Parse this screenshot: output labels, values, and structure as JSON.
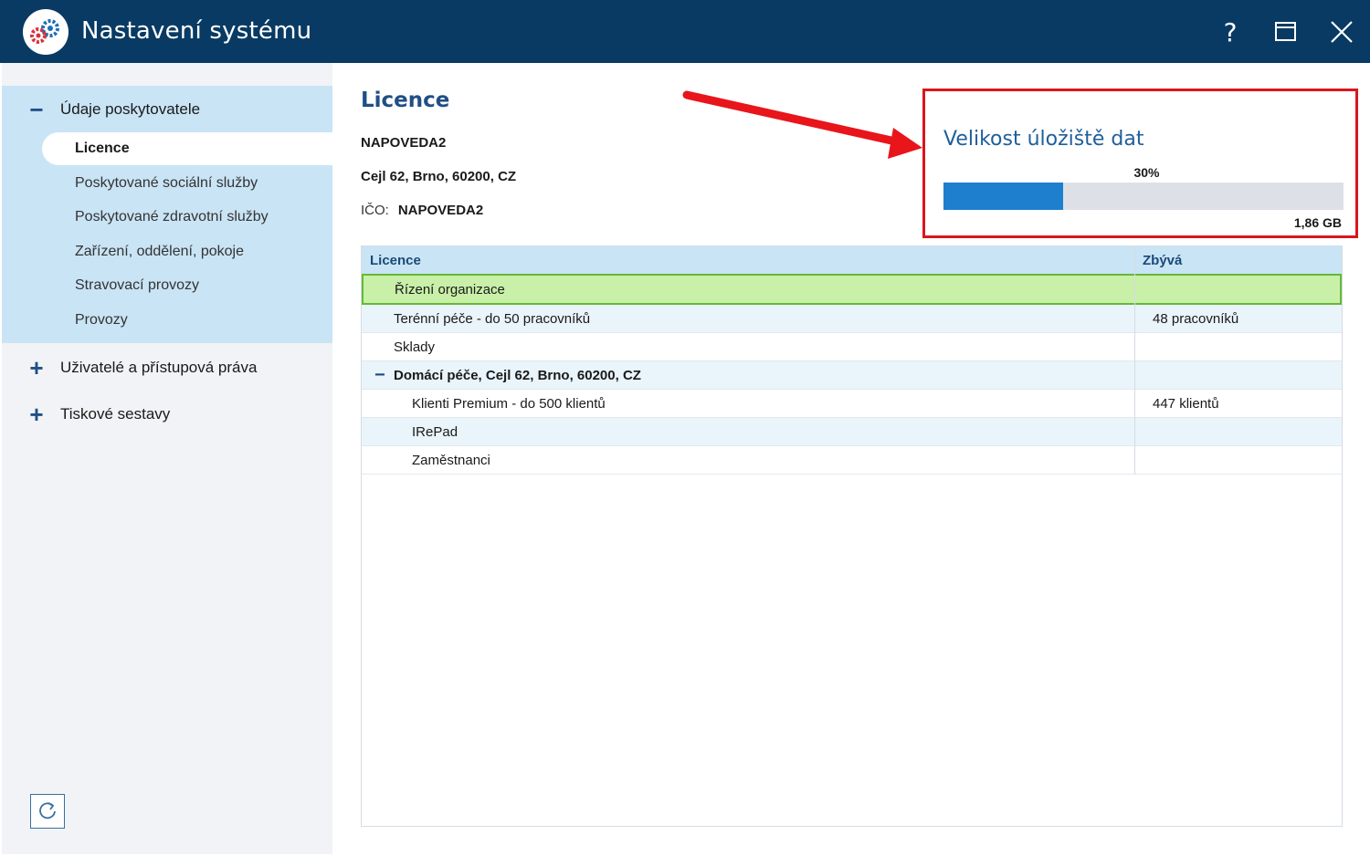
{
  "window": {
    "title": "Nastavení systému",
    "help_glyph": "?",
    "app_icon": "gears-icon"
  },
  "sidebar": {
    "groups": [
      {
        "label": "Údaje poskytovatele",
        "expanded": true,
        "items": [
          {
            "label": "Licence",
            "active": true
          },
          {
            "label": "Poskytované sociální služby"
          },
          {
            "label": "Poskytované zdravotní služby"
          },
          {
            "label": "Zařízení, oddělení, pokoje"
          },
          {
            "label": "Stravovací provozy"
          },
          {
            "label": "Provozy"
          }
        ]
      },
      {
        "label": "Uživatelé a přístupová práva",
        "expanded": false
      },
      {
        "label": "Tiskové sestavy",
        "expanded": false
      }
    ],
    "expanded_sign": "−",
    "collapsed_sign": "+"
  },
  "main": {
    "title": "Licence",
    "provider_name": "NAPOVEDA2",
    "address": "Cejl 62, Brno, 60200, CZ",
    "ico_label": "IČO:",
    "ico_value": "NAPOVEDA2"
  },
  "storage": {
    "title": "Velikost úložiště dat",
    "percent_label": "30%",
    "fraction": 0.3,
    "size": "1,86 GB",
    "fill_color": "#1e7fce",
    "highlight_color": "#d9161c"
  },
  "table": {
    "headers": {
      "name": "Licence",
      "remaining": "Zbývá"
    },
    "rows": [
      {
        "name": "Řízení organizace",
        "remaining": "",
        "selected": true
      },
      {
        "name": "Terénní péče - do 50 pracovníků",
        "remaining": "48 pracovníků"
      },
      {
        "name": "Sklady",
        "remaining": ""
      },
      {
        "name": "Domácí péče, Cejl 62, Brno, 60200, CZ",
        "remaining": "",
        "group": true,
        "sign": "−"
      },
      {
        "name": "Klienti Premium - do 500 klientů",
        "remaining": "447 klientů",
        "child": true
      },
      {
        "name": "IRePad",
        "remaining": "",
        "child": true
      },
      {
        "name": "Zaměstnanci",
        "remaining": "",
        "child": true
      }
    ]
  }
}
